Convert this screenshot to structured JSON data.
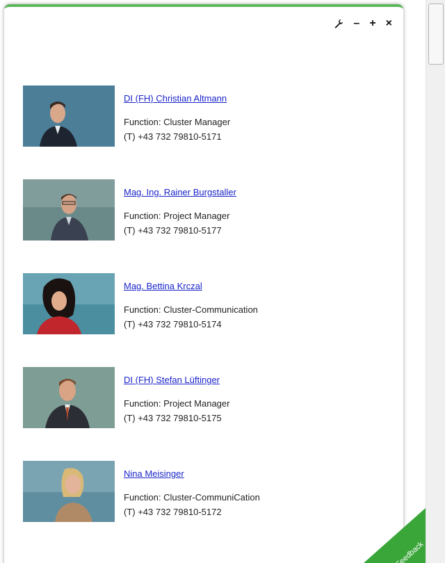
{
  "toolbar": {
    "icons": [
      "wrench-icon",
      "minimize-icon",
      "maximize-icon",
      "close-icon"
    ],
    "minimize_label": "–",
    "maximize_label": "+",
    "close_label": "×"
  },
  "contacts": [
    {
      "name": "DI (FH) Christian Altmann",
      "function": "Function: Cluster Manager",
      "phone": "(T) +43 732 79810-5171"
    },
    {
      "name": "Mag. Ing. Rainer Burgstaller",
      "function": "Function: Project Manager",
      "phone": "(T) +43 732 79810-5177"
    },
    {
      "name": "Mag. Bettina Krczal",
      "function": "Function: Cluster-Communication",
      "phone": "(T) +43 732 79810-5174"
    },
    {
      "name": "DI (FH) Stefan Lüftinger",
      "function": "Function: Project Manager",
      "phone": "(T) +43 732 79810-5175"
    },
    {
      "name": "Nina Meisinger",
      "function": "Function: Cluster-CommuniCation",
      "phone": "(T) +43 732 79810-5172"
    }
  ],
  "feedback": {
    "label": "Feedback"
  },
  "colors": {
    "accent": "#5cb85c",
    "link": "#1a24c8",
    "feedback": "#3aa63a"
  }
}
